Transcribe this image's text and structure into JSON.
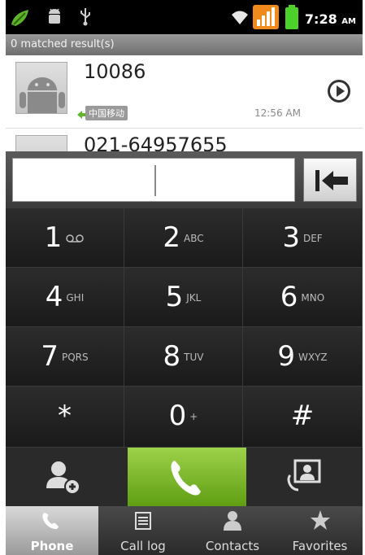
{
  "status_bar": {
    "time": "7:28",
    "ampm": "AM",
    "icons": [
      "notification-icon",
      "android-debug-icon",
      "usb-icon",
      "wifi-icon",
      "signal-icon",
      "battery-icon"
    ]
  },
  "header": {
    "matched_text": "0 matched result(s)"
  },
  "results": [
    {
      "number": "10086",
      "carrier": "中国移动",
      "time": "12:56 AM"
    },
    {
      "number": "021-64957655"
    }
  ],
  "keys": [
    {
      "digit": "1",
      "letters": ""
    },
    {
      "digit": "2",
      "letters": "ABC"
    },
    {
      "digit": "3",
      "letters": "DEF"
    },
    {
      "digit": "4",
      "letters": "GHI"
    },
    {
      "digit": "5",
      "letters": "JKL"
    },
    {
      "digit": "6",
      "letters": "MNO"
    },
    {
      "digit": "7",
      "letters": "PQRS"
    },
    {
      "digit": "8",
      "letters": "TUV"
    },
    {
      "digit": "9",
      "letters": "WXYZ"
    },
    {
      "digit": "*",
      "letters": ""
    },
    {
      "digit": "0",
      "letters": "+"
    },
    {
      "digit": "#",
      "letters": ""
    }
  ],
  "tabs": [
    {
      "label": "Phone",
      "active": true
    },
    {
      "label": "Call log",
      "active": false
    },
    {
      "label": "Contacts",
      "active": false
    },
    {
      "label": "Favorites",
      "active": false
    }
  ],
  "colors": {
    "call_green": "#7cbf2a",
    "accent_orange": "#f08a1c",
    "battery_green": "#4cd12a"
  }
}
